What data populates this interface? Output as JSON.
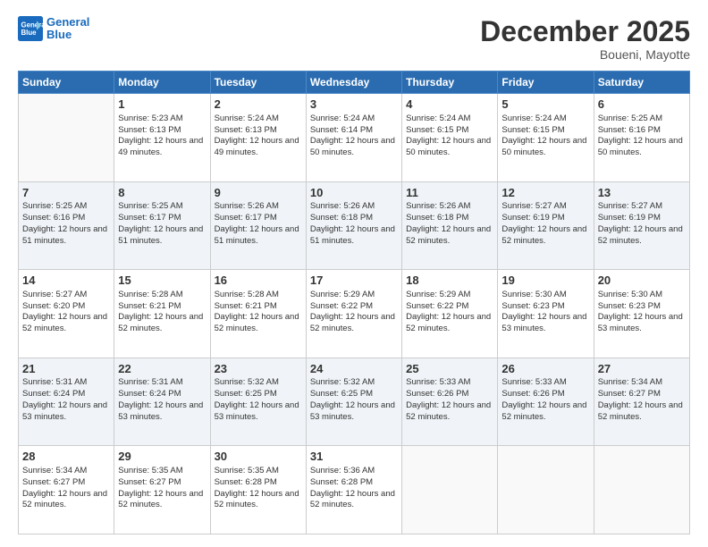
{
  "header": {
    "logo_line1": "General",
    "logo_line2": "Blue",
    "month": "December 2025",
    "location": "Boueni, Mayotte"
  },
  "days_of_week": [
    "Sunday",
    "Monday",
    "Tuesday",
    "Wednesday",
    "Thursday",
    "Friday",
    "Saturday"
  ],
  "weeks": [
    [
      {
        "day": "",
        "sunrise": "",
        "sunset": "",
        "daylight": ""
      },
      {
        "day": "1",
        "sunrise": "Sunrise: 5:23 AM",
        "sunset": "Sunset: 6:13 PM",
        "daylight": "Daylight: 12 hours and 49 minutes."
      },
      {
        "day": "2",
        "sunrise": "Sunrise: 5:24 AM",
        "sunset": "Sunset: 6:13 PM",
        "daylight": "Daylight: 12 hours and 49 minutes."
      },
      {
        "day": "3",
        "sunrise": "Sunrise: 5:24 AM",
        "sunset": "Sunset: 6:14 PM",
        "daylight": "Daylight: 12 hours and 50 minutes."
      },
      {
        "day": "4",
        "sunrise": "Sunrise: 5:24 AM",
        "sunset": "Sunset: 6:15 PM",
        "daylight": "Daylight: 12 hours and 50 minutes."
      },
      {
        "day": "5",
        "sunrise": "Sunrise: 5:24 AM",
        "sunset": "Sunset: 6:15 PM",
        "daylight": "Daylight: 12 hours and 50 minutes."
      },
      {
        "day": "6",
        "sunrise": "Sunrise: 5:25 AM",
        "sunset": "Sunset: 6:16 PM",
        "daylight": "Daylight: 12 hours and 50 minutes."
      }
    ],
    [
      {
        "day": "7",
        "sunrise": "Sunrise: 5:25 AM",
        "sunset": "Sunset: 6:16 PM",
        "daylight": "Daylight: 12 hours and 51 minutes."
      },
      {
        "day": "8",
        "sunrise": "Sunrise: 5:25 AM",
        "sunset": "Sunset: 6:17 PM",
        "daylight": "Daylight: 12 hours and 51 minutes."
      },
      {
        "day": "9",
        "sunrise": "Sunrise: 5:26 AM",
        "sunset": "Sunset: 6:17 PM",
        "daylight": "Daylight: 12 hours and 51 minutes."
      },
      {
        "day": "10",
        "sunrise": "Sunrise: 5:26 AM",
        "sunset": "Sunset: 6:18 PM",
        "daylight": "Daylight: 12 hours and 51 minutes."
      },
      {
        "day": "11",
        "sunrise": "Sunrise: 5:26 AM",
        "sunset": "Sunset: 6:18 PM",
        "daylight": "Daylight: 12 hours and 52 minutes."
      },
      {
        "day": "12",
        "sunrise": "Sunrise: 5:27 AM",
        "sunset": "Sunset: 6:19 PM",
        "daylight": "Daylight: 12 hours and 52 minutes."
      },
      {
        "day": "13",
        "sunrise": "Sunrise: 5:27 AM",
        "sunset": "Sunset: 6:19 PM",
        "daylight": "Daylight: 12 hours and 52 minutes."
      }
    ],
    [
      {
        "day": "14",
        "sunrise": "Sunrise: 5:27 AM",
        "sunset": "Sunset: 6:20 PM",
        "daylight": "Daylight: 12 hours and 52 minutes."
      },
      {
        "day": "15",
        "sunrise": "Sunrise: 5:28 AM",
        "sunset": "Sunset: 6:21 PM",
        "daylight": "Daylight: 12 hours and 52 minutes."
      },
      {
        "day": "16",
        "sunrise": "Sunrise: 5:28 AM",
        "sunset": "Sunset: 6:21 PM",
        "daylight": "Daylight: 12 hours and 52 minutes."
      },
      {
        "day": "17",
        "sunrise": "Sunrise: 5:29 AM",
        "sunset": "Sunset: 6:22 PM",
        "daylight": "Daylight: 12 hours and 52 minutes."
      },
      {
        "day": "18",
        "sunrise": "Sunrise: 5:29 AM",
        "sunset": "Sunset: 6:22 PM",
        "daylight": "Daylight: 12 hours and 52 minutes."
      },
      {
        "day": "19",
        "sunrise": "Sunrise: 5:30 AM",
        "sunset": "Sunset: 6:23 PM",
        "daylight": "Daylight: 12 hours and 53 minutes."
      },
      {
        "day": "20",
        "sunrise": "Sunrise: 5:30 AM",
        "sunset": "Sunset: 6:23 PM",
        "daylight": "Daylight: 12 hours and 53 minutes."
      }
    ],
    [
      {
        "day": "21",
        "sunrise": "Sunrise: 5:31 AM",
        "sunset": "Sunset: 6:24 PM",
        "daylight": "Daylight: 12 hours and 53 minutes."
      },
      {
        "day": "22",
        "sunrise": "Sunrise: 5:31 AM",
        "sunset": "Sunset: 6:24 PM",
        "daylight": "Daylight: 12 hours and 53 minutes."
      },
      {
        "day": "23",
        "sunrise": "Sunrise: 5:32 AM",
        "sunset": "Sunset: 6:25 PM",
        "daylight": "Daylight: 12 hours and 53 minutes."
      },
      {
        "day": "24",
        "sunrise": "Sunrise: 5:32 AM",
        "sunset": "Sunset: 6:25 PM",
        "daylight": "Daylight: 12 hours and 53 minutes."
      },
      {
        "day": "25",
        "sunrise": "Sunrise: 5:33 AM",
        "sunset": "Sunset: 6:26 PM",
        "daylight": "Daylight: 12 hours and 52 minutes."
      },
      {
        "day": "26",
        "sunrise": "Sunrise: 5:33 AM",
        "sunset": "Sunset: 6:26 PM",
        "daylight": "Daylight: 12 hours and 52 minutes."
      },
      {
        "day": "27",
        "sunrise": "Sunrise: 5:34 AM",
        "sunset": "Sunset: 6:27 PM",
        "daylight": "Daylight: 12 hours and 52 minutes."
      }
    ],
    [
      {
        "day": "28",
        "sunrise": "Sunrise: 5:34 AM",
        "sunset": "Sunset: 6:27 PM",
        "daylight": "Daylight: 12 hours and 52 minutes."
      },
      {
        "day": "29",
        "sunrise": "Sunrise: 5:35 AM",
        "sunset": "Sunset: 6:27 PM",
        "daylight": "Daylight: 12 hours and 52 minutes."
      },
      {
        "day": "30",
        "sunrise": "Sunrise: 5:35 AM",
        "sunset": "Sunset: 6:28 PM",
        "daylight": "Daylight: 12 hours and 52 minutes."
      },
      {
        "day": "31",
        "sunrise": "Sunrise: 5:36 AM",
        "sunset": "Sunset: 6:28 PM",
        "daylight": "Daylight: 12 hours and 52 minutes."
      },
      {
        "day": "",
        "sunrise": "",
        "sunset": "",
        "daylight": ""
      },
      {
        "day": "",
        "sunrise": "",
        "sunset": "",
        "daylight": ""
      },
      {
        "day": "",
        "sunrise": "",
        "sunset": "",
        "daylight": ""
      }
    ]
  ]
}
